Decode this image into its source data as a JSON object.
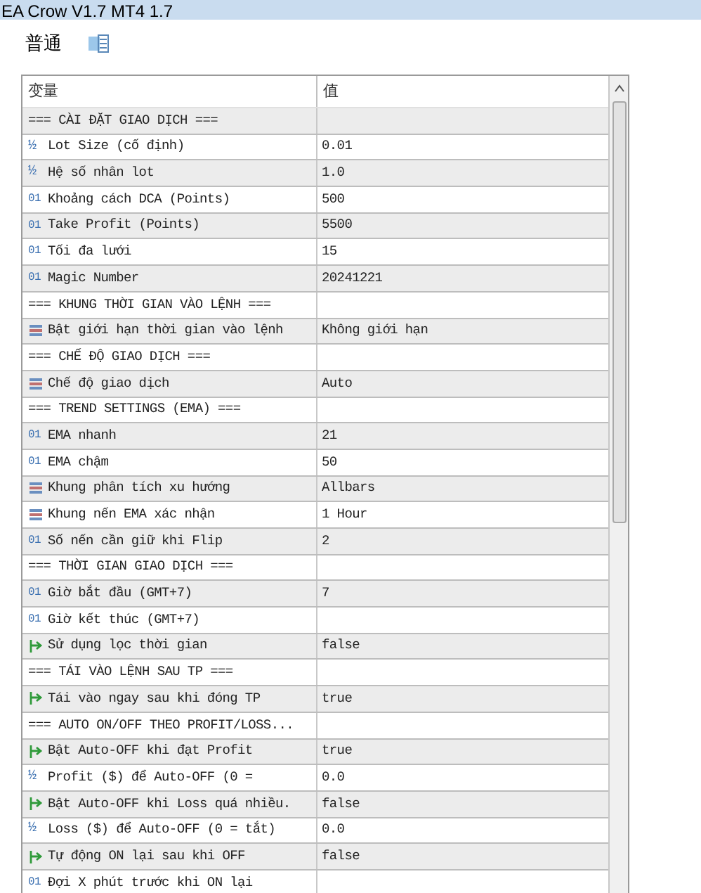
{
  "window": {
    "title": "EA Crow V1.7 MT4 1.7"
  },
  "tabs": [
    {
      "label": "普通",
      "selected": true
    },
    {
      "kind": "icon",
      "selected": false
    }
  ],
  "table": {
    "columns": [
      "变量",
      "值"
    ],
    "rows": [
      {
        "kind": "section",
        "name": "=== CÀI ĐẶT GIAO DỊCH ==="
      },
      {
        "kind": "double",
        "icon": "½",
        "name": "Lot Size (cố định)",
        "value": "0.01"
      },
      {
        "kind": "double",
        "icon": "½",
        "name": "Hệ số nhân lot",
        "value": "1.0"
      },
      {
        "kind": "int",
        "icon": "01",
        "name": "Khoảng cách DCA (Points)",
        "value": "500"
      },
      {
        "kind": "int",
        "icon": "01",
        "name": "Take Profit (Points)",
        "value": "5500"
      },
      {
        "kind": "int",
        "icon": "01",
        "name": "Tối đa lưới",
        "value": "15"
      },
      {
        "kind": "int",
        "icon": "01",
        "name": "Magic Number",
        "value": "20241221"
      },
      {
        "kind": "section",
        "name": "=== KHUNG THỜI GIAN VÀO LỆNH ==="
      },
      {
        "kind": "enum",
        "name": "Bật giới hạn thời gian vào lệnh",
        "value": "Không giới hạn"
      },
      {
        "kind": "section",
        "name": "=== CHẾ ĐỘ GIAO DỊCH ==="
      },
      {
        "kind": "enum",
        "name": "Chế độ giao dịch",
        "value": "Auto"
      },
      {
        "kind": "section",
        "name": "=== TREND SETTINGS (EMA) ==="
      },
      {
        "kind": "int",
        "icon": "01",
        "name": "EMA nhanh",
        "value": "21"
      },
      {
        "kind": "int",
        "icon": "01",
        "name": "EMA chậm",
        "value": "50"
      },
      {
        "kind": "enum",
        "name": "Khung phân tích xu hướng",
        "value": "Allbars"
      },
      {
        "kind": "enum",
        "name": "Khung nến EMA xác nhận",
        "value": "1 Hour"
      },
      {
        "kind": "int",
        "icon": "01",
        "name": "Số nến cần giữ khi Flip",
        "value": "2"
      },
      {
        "kind": "section",
        "name": "=== THỜI GIAN GIAO DỊCH ==="
      },
      {
        "kind": "int",
        "icon": "01",
        "name": "Giờ bắt đầu (GMT+7)",
        "value": "7"
      },
      {
        "kind": "int",
        "icon": "01",
        "name": "Giờ kết thúc (GMT+7)"
      },
      {
        "kind": "bool",
        "name": "Sử dụng lọc thời gian",
        "value": "false"
      },
      {
        "kind": "section",
        "name": "=== TÁI VÀO LỆNH SAU TP ==="
      },
      {
        "kind": "bool",
        "name": "Tái vào ngay sau khi đóng TP",
        "value": "true"
      },
      {
        "kind": "section",
        "name": "=== AUTO ON/OFF THEO PROFIT/LOSS..."
      },
      {
        "kind": "bool",
        "name": "Bật Auto-OFF khi đạt Profit",
        "value": "true"
      },
      {
        "kind": "double",
        "icon": "½",
        "name": "Profit ($) để Auto-OFF (0 =",
        "value": "0.0"
      },
      {
        "kind": "bool",
        "name": "Bật Auto-OFF khi Loss quá nhiều.",
        "value": "false"
      },
      {
        "kind": "double",
        "icon": "½",
        "name": "Loss ($) để Auto-OFF (0 = tắt)",
        "value": "0.0"
      },
      {
        "kind": "bool",
        "name": "Tự động ON lại sau khi OFF",
        "value": "false"
      },
      {
        "kind": "int",
        "icon": "01",
        "name": "Đợi X phút trước khi ON lại"
      }
    ]
  }
}
